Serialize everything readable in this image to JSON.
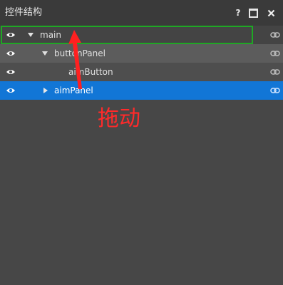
{
  "panel": {
    "title": "控件结构",
    "help_label": "?"
  },
  "tree": {
    "rows": [
      {
        "label": "main",
        "expanded": true,
        "visible": true
      },
      {
        "label": "buttonPanel",
        "expanded": true,
        "visible": true
      },
      {
        "label": "aimButton",
        "visible": true
      },
      {
        "label": "aimPanel",
        "expanded": false,
        "visible": true,
        "selected": true
      }
    ]
  },
  "annotation": {
    "text": "拖动",
    "color": "#ff2a2a",
    "box_color": "#1fa824"
  },
  "icons": {
    "visibility": "eye-icon",
    "link": "link-icon",
    "expand": "triangle-down-icon",
    "collapse": "triangle-right-icon"
  },
  "colors": {
    "selection": "#1276d6",
    "background": "#474747"
  }
}
